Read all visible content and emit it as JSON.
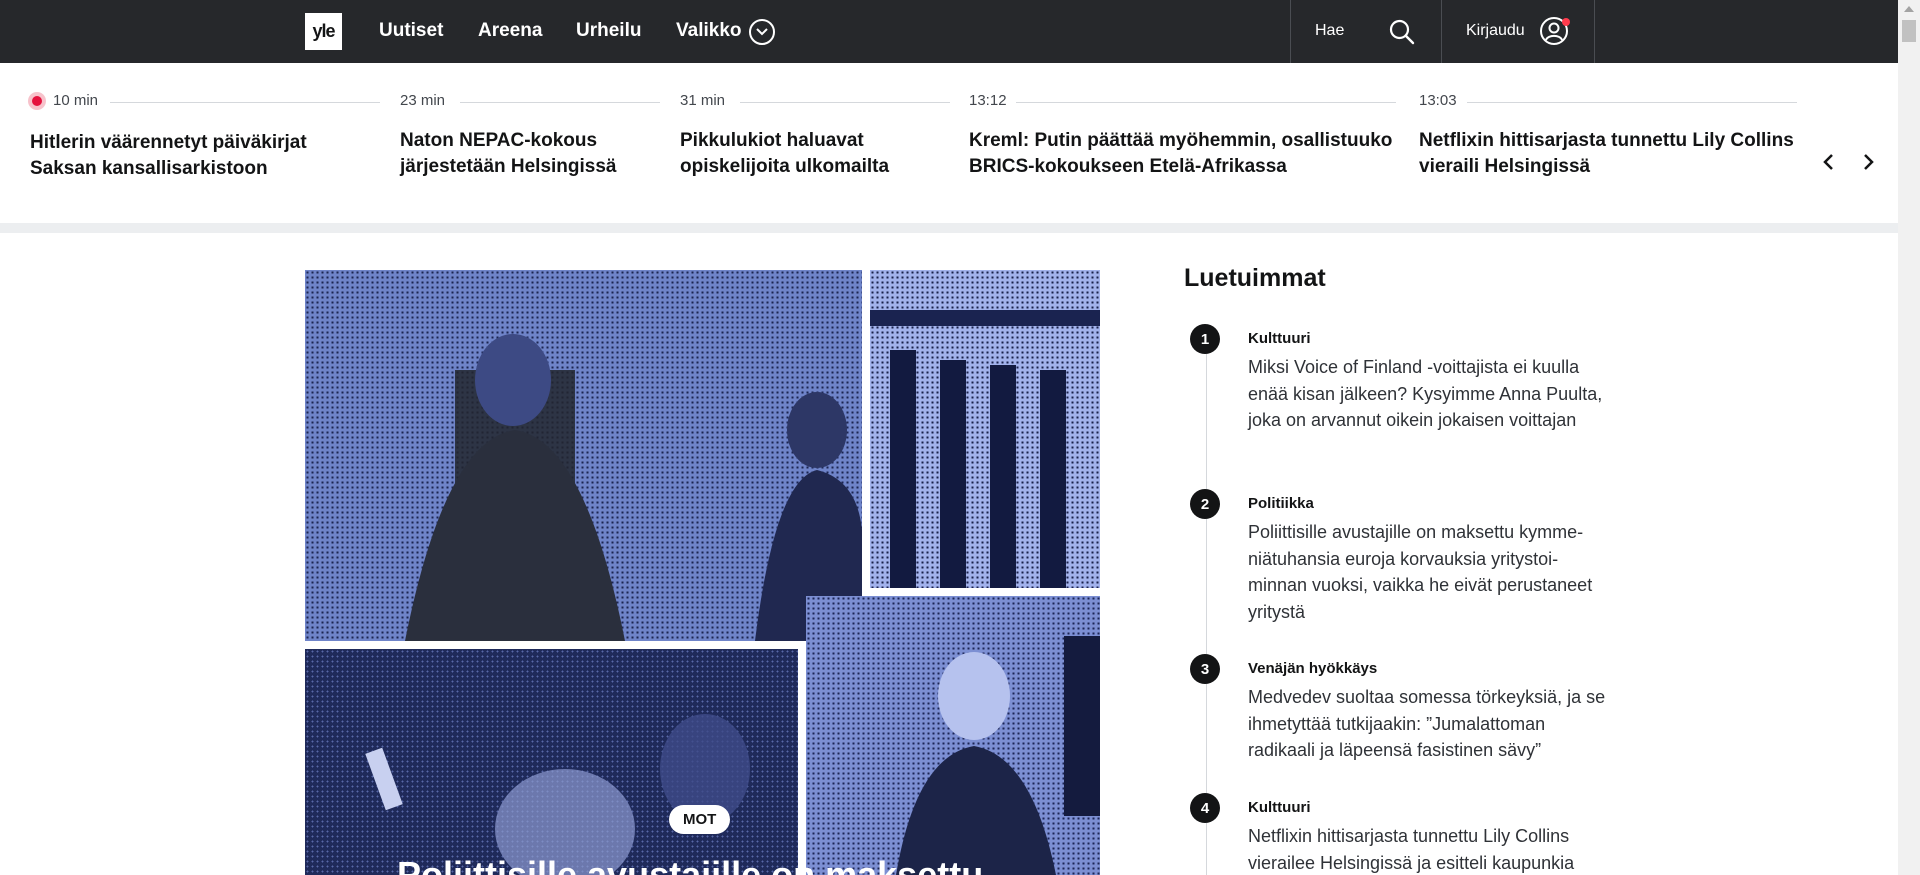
{
  "nav": {
    "logo": "yle",
    "links": [
      "Uutiset",
      "Areena",
      "Urheilu",
      "Valikko"
    ],
    "search_label": "Hae",
    "login_label": "Kirjaudu"
  },
  "ticker": [
    {
      "time": "10 min",
      "title": "Hitlerin väärennetyt päiväkirjat Saksan kansallisarkistoon",
      "live": true
    },
    {
      "time": "23 min",
      "title": "Naton NEPAC-kokous järjestetään Helsingissä"
    },
    {
      "time": "31 min",
      "title": "Pikkulukiot haluavat opiskelijoita ulkomailta"
    },
    {
      "time": "13:12",
      "title": "Kreml: Putin päättää myöhemmin, osallistuuko BRICS-kokoukseen Etelä-Afrikassa"
    },
    {
      "time": "13:03",
      "title": "Netflixin hittisarjasta tunnettu Lily Collins vieraili Helsingissä"
    }
  ],
  "hero": {
    "badge": "MOT",
    "headline": "Poliittisille avustajille on maksettu"
  },
  "most_read": {
    "title": "Luetuimmat",
    "items": [
      {
        "rank": "1",
        "category": "Kulttuuri",
        "text": "Miksi Voice of Finland -voittajista ei kuulla enää kisan jälkeen? Kysyimme Anna Puulta, joka on arvannut oikein jokaisen voittajan"
      },
      {
        "rank": "2",
        "category": "Politiikka",
        "text": "Poliittisille avustajille on maksettu kymme-niätuhansia euroja korvauksia yritystoi-minnan vuoksi, vaikka he eivät perustaneet yritystä"
      },
      {
        "rank": "3",
        "category": "Venäjän hyökkäys",
        "text": "Medvedev suoltaa somessa törkeyksiä, ja se ihmetyttää tutkijaakin: ”Jumalattoman radikaali ja läpeensä fasistinen sävy”"
      },
      {
        "rank": "4",
        "category": "Kulttuuri",
        "text": "Netflixin hittisarjasta tunnettu Lily Collins vierailee Helsingissä ja esitteli kaupunkia"
      }
    ]
  },
  "colors": {
    "nav_bg": "#26282b",
    "live_red": "#e5113d",
    "hero_blue": "#7c8fd3"
  }
}
